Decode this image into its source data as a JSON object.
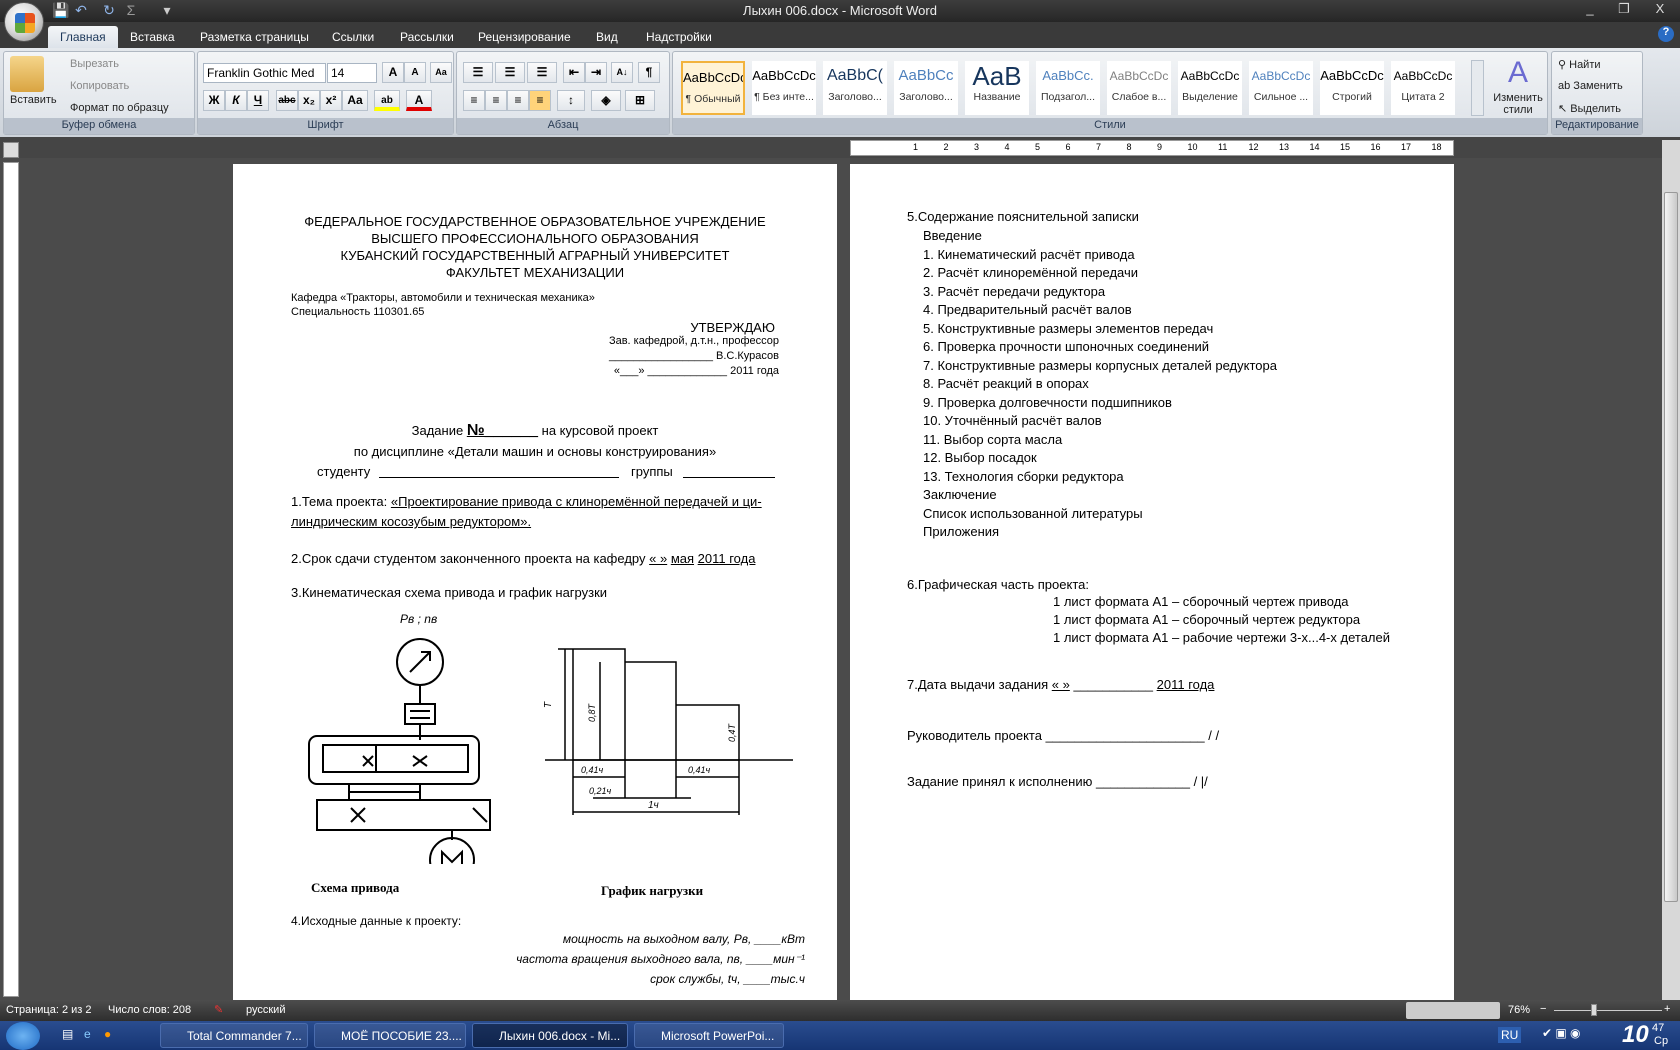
{
  "window": {
    "title": "Лыхин 006.docx - Microsoft Word",
    "minimize": "_",
    "restore": "❐",
    "close": "X"
  },
  "qat": {
    "save": "💾",
    "undo": "↶",
    "redo": "↻",
    "sum": "Σ",
    "customize": "▾"
  },
  "tabs": [
    "Главная",
    "Вставка",
    "Разметка страницы",
    "Ссылки",
    "Рассылки",
    "Рецензирование",
    "Вид",
    "Надстройки"
  ],
  "help": "?",
  "clipboard": {
    "paste": "Вставить",
    "cut": "Вырезать",
    "copy": "Копировать",
    "format_painter": "Формат по образцу",
    "label": "Буфер обмена"
  },
  "font": {
    "name": "Franklin Gothic Med",
    "size": "14",
    "grow": "A",
    "shrink": "A",
    "clear": "Aa",
    "bold": "Ж",
    "italic": "К",
    "underline": "Ч",
    "strike": "abc",
    "sub": "x₂",
    "sup": "x²",
    "case": "Aa",
    "highlight": "ab",
    "color": "A",
    "label": "Шрифт",
    "highlight_color": "#ffff00",
    "font_color": "#e00000"
  },
  "paragraph": {
    "label": "Абзац",
    "sort": "А↓",
    "pilcrow": "¶"
  },
  "styles": {
    "label": "Стили",
    "items": [
      {
        "preview": "AaBbCcDc",
        "name": "¶ Обычный"
      },
      {
        "preview": "AaBbCcDc",
        "name": "¶ Без инте..."
      },
      {
        "preview": "AaBbC(",
        "name": "Заголово..."
      },
      {
        "preview": "AaBbCc",
        "name": "Заголово..."
      },
      {
        "preview": "AaB",
        "name": "Название"
      },
      {
        "preview": "AaBbCc.",
        "name": "Подзагол..."
      },
      {
        "preview": "AaBbCcDc",
        "name": "Слабое в..."
      },
      {
        "preview": "AaBbCcDc",
        "name": "Выделение"
      },
      {
        "preview": "AaBbCcDc",
        "name": "Сильное ..."
      },
      {
        "preview": "AaBbCcDc",
        "name": "Строгий"
      },
      {
        "preview": "AaBbCcDc",
        "name": "Цитата 2"
      }
    ],
    "change": "Изменить стили"
  },
  "editing": {
    "find": "Найти",
    "replace": "Заменить",
    "select": "Выделить",
    "label": "Редактирование"
  },
  "ruler_numbers": [
    "1",
    "2",
    "3",
    "4",
    "5",
    "6",
    "7",
    "8",
    "9",
    "10",
    "11",
    "12",
    "13",
    "14",
    "15",
    "16",
    "17",
    "18"
  ],
  "page1": {
    "header": [
      "ФЕДЕРАЛЬНОЕ ГОСУДАРСТВЕННОЕ ОБРАЗОВАТЕЛЬНОЕ УЧРЕЖДЕНИЕ",
      "ВЫСШЕГО ПРОФЕССИОНАЛЬНОГО ОБРАЗОВАНИЯ",
      "КУБАНСКИЙ ГОСУДАРСТВЕННЫЙ АГРАРНЫЙ УНИВЕРСИТЕТ",
      "ФАКУЛЬТЕТ МЕХАНИЗАЦИИ"
    ],
    "kafedra": "Кафедра «Тракторы, автомобили и техническая механика»",
    "specialty": "Специальность  110301.65",
    "approve": "УТВЕРЖДАЮ",
    "approve_role": "Зав. кафедрой, д.т.н., профессор",
    "approve_name": "_________________ В.С.Курасов",
    "approve_date": "«___» _____________  2011 года",
    "task_prefix": "Задание ",
    "task_no": "№______",
    "task_suffix": " на курсовой проект",
    "discipline": "по дисциплине «Детали машин и основы конструирования»",
    "student": "студенту",
    "group": "группы",
    "item1_label": "1.Тема  проекта: ",
    "item1_line1": "«Проектирование  привода  с  клиноремённой  передачей  и  ци-",
    "item1_line2": "линдрическим косозубым редуктором».",
    "item2_label": "2.Срок сдачи студентом законченного проекта  на кафедру ",
    "item2_date": "«      »",
    "item2_month": "мая",
    "item2_year": "2011 года",
    "item3": "3.Кинематическая схема привода и график нагрузки",
    "scheme_top_label": "Pв ; nв",
    "scheme_caption": "Схема привода",
    "graph_caption": "График нагрузки",
    "graph_labels": {
      "t": "T",
      "t08": "0,8T",
      "t04": "0,4T",
      "d1": "0,41ч",
      "d2": "0,41ч",
      "d3": "0,21ч",
      "total": "1ч"
    },
    "item4": "4.Исходные данные к проекту:",
    "param1": "мощность на выходном  валу, Pв,  ____кВт",
    "param2": "частота вращения выходного  вала,  nв,  ____мин⁻¹",
    "param3": "срок службы, tч,  ____тыс.ч"
  },
  "page2": {
    "item5": "5.Содержание пояснительной записки",
    "contents": [
      "Введение",
      "1. Кинематический расчёт привода",
      "2. Расчёт клиноремённой передачи",
      "3. Расчёт передачи редуктора",
      "4. Предварительный расчёт валов",
      "5. Конструктивные размеры элементов передач",
      "6. Проверка прочности шпоночных соединений",
      "7. Конструктивные размеры корпусных деталей редуктора",
      "8. Расчёт реакций в опорах",
      "9. Проверка долговечности подшипников",
      "10. Уточнённый расчёт валов",
      "11. Выбор сорта масла",
      "12. Выбор посадок",
      "13. Технология сборки редуктора",
      "Заключение",
      "Список использованной литературы",
      "Приложения"
    ],
    "item6": "6.Графическая часть проекта:",
    "sheets": [
      "1 лист формата А1 – сборочный чертеж привода",
      "1 лист формата А1 – сборочный чертеж редуктора",
      "1 лист формата А1 – рабочие чертежи 3-х...4-х деталей"
    ],
    "item7": "7.Дата выдачи задания ",
    "item7_day": "«      »",
    "item7_month": "___________",
    "item7_year": "2011 года",
    "supervisor": "Руководитель  проекта  ______________________  /                    /",
    "accepted": "Задание принял к исполнению  _____________  /                    |/"
  },
  "status": {
    "page": "Страница: 2 из 2",
    "words": "Число слов: 208",
    "language": "русский",
    "zoom": "76%",
    "minus": "−",
    "plus": "+",
    "zoom_level_percent": 76
  },
  "taskbar": {
    "items": [
      "Total Commander 7...",
      "МОЁ ПОСОБИЕ 23....",
      "Лыхин 006.docx - Mi...",
      "Microsoft PowerPoi..."
    ],
    "lang": "RU",
    "clock": "10",
    "clock_min": "47",
    "day": "Ср"
  }
}
